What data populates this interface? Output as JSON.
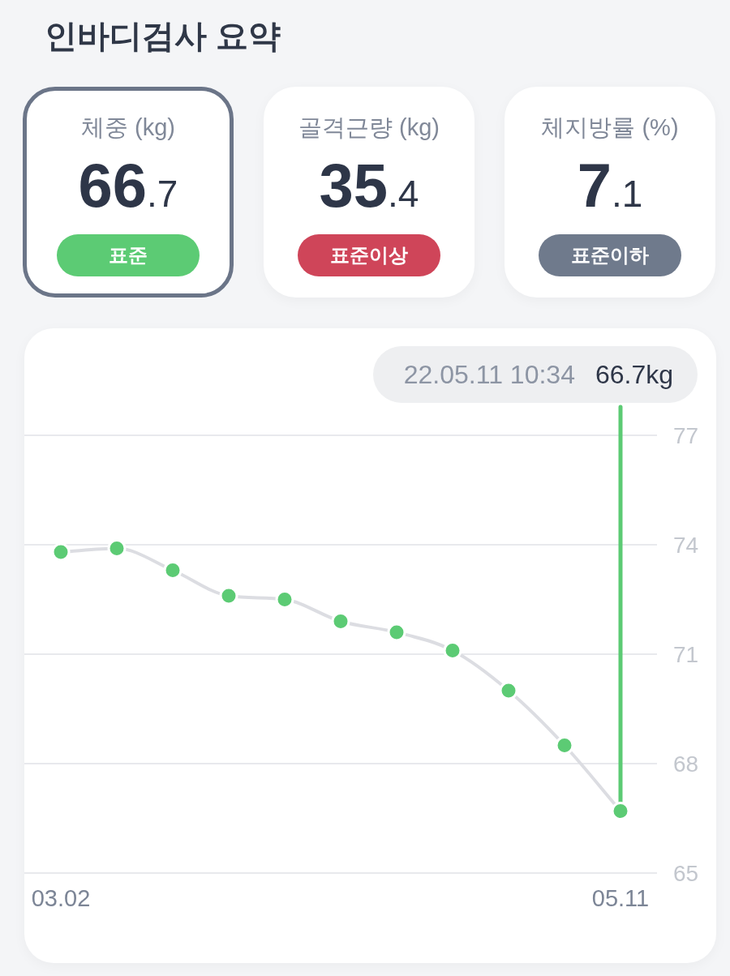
{
  "header": {
    "title": "인바디검사 요약"
  },
  "metrics": [
    {
      "label": "체중 (kg)",
      "value": "66.7",
      "status": "표준",
      "color": "#5ccb74",
      "selected": true
    },
    {
      "label": "골격근량 (kg)",
      "value": "35.4",
      "status": "표준이상",
      "color": "#cf4559",
      "selected": false
    },
    {
      "label": "체지방률 (%)",
      "value": "7.1",
      "status": "표준이하",
      "color": "#6f7a8c",
      "selected": false
    }
  ],
  "chart": {
    "tooltip": {
      "datetime": "22.05.11 10:34",
      "value": "66.7kg"
    },
    "chart_data": {
      "type": "line",
      "categories": [
        "03.02",
        null,
        null,
        null,
        null,
        null,
        null,
        null,
        null,
        null,
        "05.11"
      ],
      "ylim": [
        65,
        77
      ],
      "yticks": [
        65,
        68,
        71,
        74,
        77
      ],
      "grid": true,
      "series": [
        {
          "color": "#dcdde2",
          "marker": {
            "color": "#5ccb74"
          },
          "values": [
            73.8,
            73.9,
            73.3,
            72.6,
            72.5,
            71.9,
            71.6,
            71.1,
            70.0,
            68.5,
            66.7
          ]
        }
      ],
      "annotations": [
        {
          "x": "05.11"
        }
      ]
    }
  }
}
